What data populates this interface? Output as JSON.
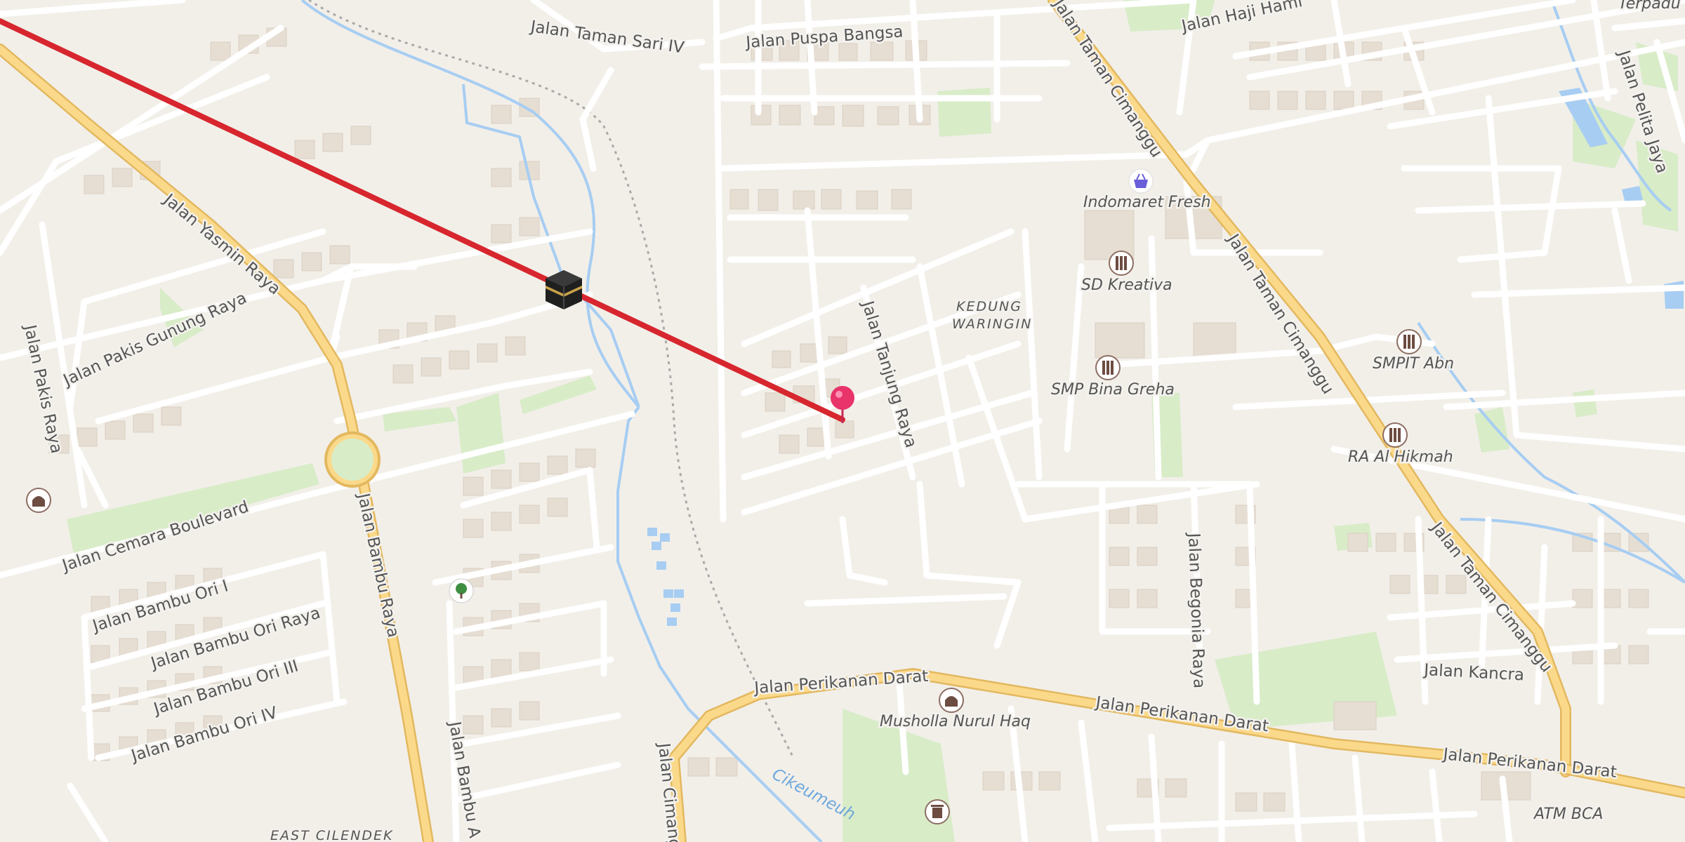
{
  "streets": {
    "taman_sari_iv": "Jalan Taman Sari IV",
    "puspa_bangsa": "Jalan Puspa Bangsa",
    "haji_hamid": "Jalan Haji Hami",
    "taman_cimanggu_top": "Jalan Taman Cimanggu",
    "yasmin_raya": "Jalan Yasmin Raya",
    "pakis_gunung_raya": "Jalan Pakis Gunung Raya",
    "pakis_raya": "Jalan Pakis Raya",
    "cemara_boulevard": "Jalan Cemara Boulevard",
    "bambu_ori_i": "Jalan Bambu Ori I",
    "bambu_ori_raya": "Jalan Bambu Ori Raya",
    "bambu_ori_iii": "Jalan Bambu Ori III",
    "bambu_ori_iv": "Jalan Bambu Ori IV",
    "bambu_raya": "Jalan Bambu Raya",
    "bambu_a": "Jalan Bambu A",
    "tanjung_raya": "Jalan Tanjung Raya",
    "taman_cimanggu": "Jalan Taman Cimanggu",
    "taman_cimanggu_2": "Jalan Taman Cimanggu",
    "pelita_jaya": "Jalan Pelita Jaya",
    "begonia_raya": "Jalan Begonia Raya",
    "kancra": "Jalan Kancra",
    "perikanan_darat_1": "Jalan Perikanan Darat",
    "perikanan_darat_2": "Jalan Perikanan Darat",
    "perikanan_darat_3": "Jalan Perikanan Darat",
    "jalan_cimanggu": "Jalan Cimanggu",
    "terpadu": "Terpadu"
  },
  "areas": {
    "kedung_line1": "KEDUNG",
    "kedung_line2": "WARINGIN",
    "east_cilendek": "EAST CILENDEK"
  },
  "water": {
    "river": "Cikeumeuh"
  },
  "pois": {
    "indomaret": "Indomaret Fresh",
    "sd_kreativa": "SD Kreativa",
    "smp_bina_greha": "SMP Bina Greha",
    "smpit_abn": "SMPIT Abn",
    "ra_al_hikmah": "RA Al Hikmah",
    "musholla": "Musholla Nurul Haq",
    "atm_bca": "ATM BCA"
  },
  "icons": {
    "kaaba": "kaaba-icon",
    "location_pin": "location-pin-icon",
    "shop": "shopping-basket-icon",
    "school": "school-icon",
    "mosque": "mosque-icon",
    "park": "tree-icon",
    "trash": "waste-basket-icon"
  },
  "colors": {
    "background": "#f2efe9",
    "minor_road": "#ffffff",
    "major_road": "#fbd98a",
    "major_road_casing": "#e3b85f",
    "qibla_line": "#d7262e",
    "pin": "#e8336b",
    "water": "#a7cdf2",
    "park": "#d8ecc8"
  }
}
